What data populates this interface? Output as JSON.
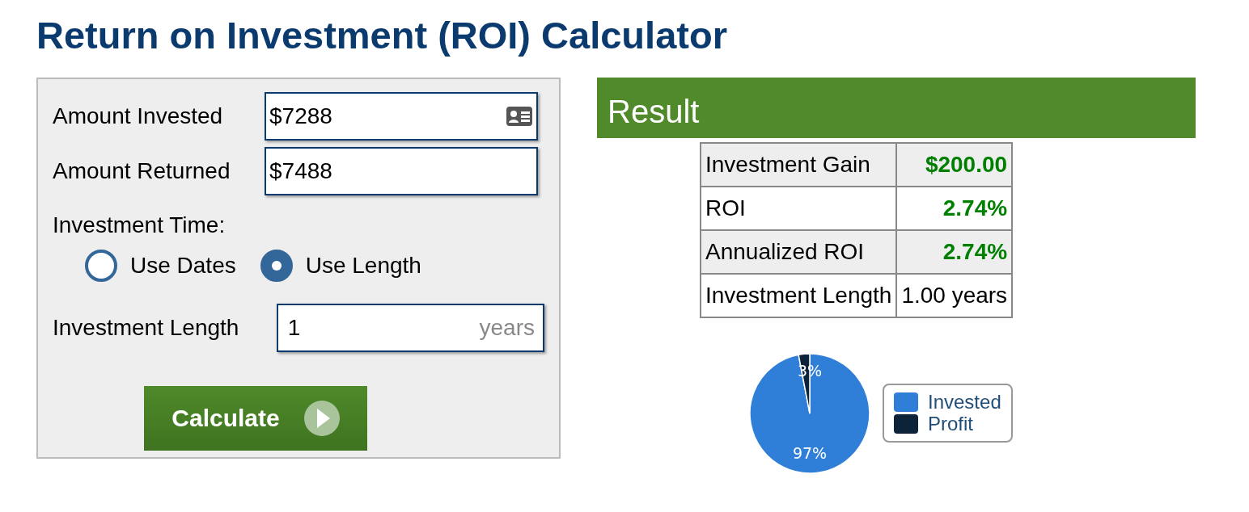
{
  "title": "Return on Investment (ROI) Calculator",
  "form": {
    "fields": [
      {
        "label": "Amount Invested",
        "value": "$7288",
        "kind": "card"
      },
      {
        "label": "Amount Returned",
        "value": "$7488",
        "kind": "plain"
      }
    ],
    "time_label": "Investment Time:",
    "options": [
      {
        "label": "Use Dates",
        "selected": false
      },
      {
        "label": "Use Length",
        "selected": true
      }
    ],
    "length": {
      "label": "Investment Length",
      "value": "1",
      "unit": "years"
    },
    "button": "Calculate"
  },
  "result": {
    "title": "Result",
    "rows": [
      {
        "label": "Investment Gain",
        "value": "$200.00",
        "highlight": true
      },
      {
        "label": "ROI",
        "value": "2.74%",
        "highlight": true
      },
      {
        "label": "Annualized ROI",
        "value": "2.74%",
        "highlight": true
      },
      {
        "label": "Investment Length",
        "value": "1.00 years",
        "highlight": false
      }
    ],
    "chart_data": {
      "type": "pie",
      "categories": [
        "Invested",
        "Profit"
      ],
      "values": [
        97,
        3
      ],
      "colors": [
        "#2f7ed8",
        "#0d233a"
      ],
      "legend": "right",
      "value_labels": [
        "97%",
        "3%"
      ]
    }
  }
}
